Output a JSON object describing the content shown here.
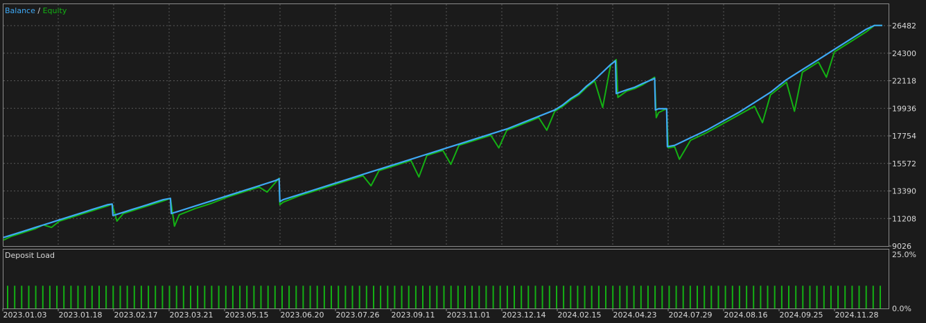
{
  "chart_data": [
    {
      "type": "line",
      "panel": "main",
      "legend": {
        "balance_label": "Balance",
        "separator": " / ",
        "equity_label": "Equity"
      },
      "y_ticks": [
        "26482",
        "24300",
        "22118",
        "19936",
        "17754",
        "15572",
        "13390",
        "11208",
        "9026"
      ],
      "ylim": [
        9026,
        27300
      ],
      "x_range": [
        0,
        100
      ],
      "series": [
        {
          "name": "Balance",
          "color": "#3fa9f5",
          "points": [
            [
              0,
              9700
            ],
            [
              1,
              9900
            ],
            [
              2,
              10100
            ],
            [
              3,
              10300
            ],
            [
              4,
              10500
            ],
            [
              5,
              10700
            ],
            [
              6,
              10900
            ],
            [
              7,
              11100
            ],
            [
              8,
              11300
            ],
            [
              9,
              11500
            ],
            [
              10,
              11700
            ],
            [
              11,
              11900
            ],
            [
              12,
              12100
            ],
            [
              13,
              12300
            ],
            [
              13.6,
              12350
            ],
            [
              13.7,
              11450
            ],
            [
              14,
              11500
            ],
            [
              15,
              11700
            ],
            [
              16,
              11900
            ],
            [
              17,
              12100
            ],
            [
              18,
              12300
            ],
            [
              19,
              12500
            ],
            [
              20,
              12700
            ],
            [
              20.9,
              12800
            ],
            [
              21.0,
              11600
            ],
            [
              22,
              11800
            ],
            [
              24,
              12200
            ],
            [
              26,
              12600
            ],
            [
              28,
              13000
            ],
            [
              30,
              13400
            ],
            [
              32,
              13800
            ],
            [
              34,
              14200
            ],
            [
              34.5,
              14350
            ],
            [
              34.6,
              12550
            ],
            [
              35,
              12700
            ],
            [
              37,
              13100
            ],
            [
              39,
              13500
            ],
            [
              41,
              13900
            ],
            [
              43,
              14300
            ],
            [
              45,
              14700
            ],
            [
              47,
              15100
            ],
            [
              49,
              15500
            ],
            [
              51,
              15900
            ],
            [
              53,
              16300
            ],
            [
              55,
              16700
            ],
            [
              57,
              17100
            ],
            [
              59,
              17500
            ],
            [
              61,
              17900
            ],
            [
              63,
              18300
            ],
            [
              65,
              18800
            ],
            [
              67,
              19300
            ],
            [
              69,
              19800
            ],
            [
              70,
              20200
            ],
            [
              71,
              20700
            ],
            [
              72,
              21100
            ],
            [
              73,
              21700
            ],
            [
              74,
              22200
            ],
            [
              76,
              23400
            ],
            [
              76.6,
              23700
            ],
            [
              76.7,
              21100
            ],
            [
              78,
              21400
            ],
            [
              79,
              21600
            ],
            [
              80,
              21900
            ],
            [
              81.5,
              22300
            ],
            [
              81.6,
              19800
            ],
            [
              82,
              19900
            ],
            [
              83,
              19900
            ],
            [
              83.1,
              16900
            ],
            [
              84,
              17000
            ],
            [
              86,
              17600
            ],
            [
              88,
              18200
            ],
            [
              90,
              18900
            ],
            [
              92,
              19600
            ],
            [
              94,
              20400
            ],
            [
              96,
              21200
            ],
            [
              98,
              22200
            ],
            [
              100,
              23000
            ],
            [
              102,
              23800
            ],
            [
              104,
              24600
            ],
            [
              106,
              25400
            ],
            [
              108,
              26200
            ],
            [
              109,
              26500
            ],
            [
              110,
              26500
            ]
          ]
        },
        {
          "name": "Equity",
          "color": "#13b113",
          "points": [
            [
              0,
              9500
            ],
            [
              1,
              9800
            ],
            [
              2,
              10000
            ],
            [
              3,
              10200
            ],
            [
              4,
              10400
            ],
            [
              5,
              10700
            ],
            [
              6,
              10500
            ],
            [
              7,
              11000
            ],
            [
              8,
              11200
            ],
            [
              9,
              11400
            ],
            [
              10,
              11600
            ],
            [
              11,
              11800
            ],
            [
              12,
              12000
            ],
            [
              13,
              12200
            ],
            [
              13.6,
              12350
            ],
            [
              14.2,
              11000
            ],
            [
              15,
              11600
            ],
            [
              16,
              11800
            ],
            [
              17,
              12000
            ],
            [
              18,
              12200
            ],
            [
              19,
              12400
            ],
            [
              20,
              12600
            ],
            [
              20.9,
              12800
            ],
            [
              21.4,
              10600
            ],
            [
              22,
              11500
            ],
            [
              24,
              12000
            ],
            [
              26,
              12400
            ],
            [
              28,
              12900
            ],
            [
              30,
              13300
            ],
            [
              32,
              13700
            ],
            [
              33,
              13300
            ],
            [
              34.5,
              14400
            ],
            [
              34.6,
              12300
            ],
            [
              35,
              12500
            ],
            [
              37,
              13000
            ],
            [
              39,
              13400
            ],
            [
              41,
              13800
            ],
            [
              43,
              14200
            ],
            [
              45,
              14600
            ],
            [
              46,
              13800
            ],
            [
              47,
              15000
            ],
            [
              49,
              15400
            ],
            [
              51,
              15800
            ],
            [
              52,
              14500
            ],
            [
              53,
              16200
            ],
            [
              55,
              16600
            ],
            [
              56,
              15500
            ],
            [
              57,
              17000
            ],
            [
              59,
              17400
            ],
            [
              61,
              17800
            ],
            [
              62,
              16800
            ],
            [
              63,
              18200
            ],
            [
              65,
              18700
            ],
            [
              67,
              19200
            ],
            [
              68,
              18200
            ],
            [
              69,
              19700
            ],
            [
              70,
              20100
            ],
            [
              71,
              20600
            ],
            [
              72,
              21000
            ],
            [
              73,
              21600
            ],
            [
              74,
              22100
            ],
            [
              75,
              20000
            ],
            [
              76,
              23400
            ],
            [
              76.7,
              23800
            ],
            [
              76.9,
              20800
            ],
            [
              78,
              21300
            ],
            [
              79,
              21500
            ],
            [
              80,
              21800
            ],
            [
              81.5,
              22400
            ],
            [
              81.7,
              19200
            ],
            [
              82,
              19600
            ],
            [
              83,
              19900
            ],
            [
              83.2,
              16800
            ],
            [
              84,
              16900
            ],
            [
              84.6,
              15900
            ],
            [
              86,
              17400
            ],
            [
              88,
              18000
            ],
            [
              90,
              18700
            ],
            [
              92,
              19400
            ],
            [
              94,
              20100
            ],
            [
              95,
              18800
            ],
            [
              96,
              21000
            ],
            [
              98,
              22000
            ],
            [
              99,
              19700
            ],
            [
              100,
              22800
            ],
            [
              102,
              23600
            ],
            [
              103,
              22400
            ],
            [
              104,
              24400
            ],
            [
              106,
              25200
            ],
            [
              108,
              26000
            ],
            [
              109,
              26500
            ],
            [
              110,
              26500
            ]
          ]
        }
      ]
    },
    {
      "type": "bar",
      "panel": "deposit-load",
      "title": "Deposit Load",
      "y_ticks": [
        "25.0%",
        "0.0%"
      ],
      "ylim": [
        0,
        25
      ],
      "color": "#13b113",
      "bar_count": 125,
      "bar_value": 10.5
    }
  ],
  "x_axis": {
    "tick_labels": [
      "2023.01.03",
      "2023.01.18",
      "2023.02.17",
      "2023.03.21",
      "2023.05.15",
      "2023.06.20",
      "2023.07.26",
      "2023.09.11",
      "2023.11.01",
      "2023.12.14",
      "2024.02.15",
      "2024.04.23",
      "2024.07.29",
      "2024.08.16",
      "2024.09.25",
      "2024.11.28"
    ]
  }
}
